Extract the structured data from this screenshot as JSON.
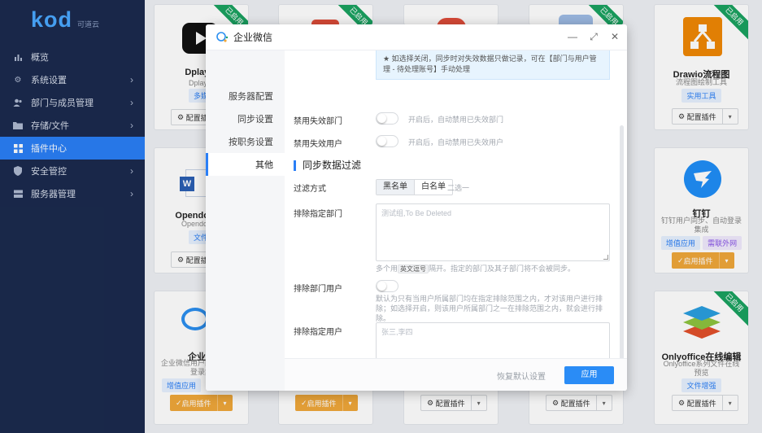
{
  "brand": {
    "logo": "kod",
    "logo_cn": "可道云"
  },
  "sidebar": {
    "items": [
      {
        "label": "概览",
        "icon": "bar-chart-icon"
      },
      {
        "label": "系统设置",
        "icon": "gear-icon"
      },
      {
        "label": "部门与成员管理",
        "icon": "users-icon"
      },
      {
        "label": "存储/文件",
        "icon": "folder-icon"
      },
      {
        "label": "插件中心",
        "icon": "grid-icon"
      },
      {
        "label": "安全管控",
        "icon": "shield-icon"
      },
      {
        "label": "服务器管理",
        "icon": "server-icon"
      }
    ]
  },
  "cards": {
    "dplayer": {
      "title": "Dplayer",
      "desc": "Dplayer",
      "tag": "多媒",
      "config": "配置插"
    },
    "drawio": {
      "title": "Drawio流程图",
      "desc": "流程图绘制工具",
      "tag": "实用工具",
      "config": "配置插件",
      "badge": "已启用"
    },
    "opendoc": {
      "title": "Opendocum",
      "desc": "Opendocum",
      "tag": "文件",
      "config": "配置插"
    },
    "dingtalk": {
      "title": "钉钉",
      "desc": "钉钉用户同步、自动登录集成",
      "tag1": "增值应用",
      "tag2": "需联外网",
      "enable": "启用插件"
    },
    "wework": {
      "title": "企业微",
      "desc": "企业微信用户同步、自动登录集",
      "tag": "增值应用",
      "enable": "启用插件"
    },
    "onlyoffice": {
      "title": "Onlyoffice在线编辑",
      "desc": "Onlyoffice系列文件在线预览",
      "tag": "文件增强",
      "config": "配置插件",
      "badge": "已启用"
    },
    "bottom2": {
      "enable": "启用插件"
    },
    "bottom3": {
      "config": "配置插件"
    },
    "bottom4": {
      "config": "配置插件"
    },
    "badge_text": "已启用"
  },
  "modal": {
    "title": "企业微信",
    "tabs": [
      "服务器配置",
      "同步设置",
      "按职务设置",
      "其他"
    ],
    "notice": "★ 如选择关闭，同步时对失效数据只做记录，可在【部门与用户管理 - 待处理账号】手动处理",
    "disable_dept_label": "禁用失效部门",
    "disable_dept_hint": "开启后，自动禁用已失效部门",
    "disable_user_label": "禁用失效用户",
    "disable_user_hint": "开启后，自动禁用已失效用户",
    "section_title": "同步数据过滤",
    "filter_label": "过滤方式",
    "filter_options": [
      "黑名单",
      "白名单"
    ],
    "filter_hint": "二选一",
    "exclude_dept_label": "排除指定部门",
    "exclude_dept_placeholder": "测试组,To Be Deleted",
    "exclude_dept_hint_a": "多个用",
    "exclude_dept_hint_kbd": "英文逗号",
    "exclude_dept_hint_b": "隔开。指定的部门及其子部门将不会被同步。",
    "exclude_dept_user_label": "排除部门用户",
    "exclude_dept_user_hint": "默认为只有当用户所属部门均在指定排除范围之内，才对该用户进行排除；如选择开启，则该用户所属部门之一在排除范围之内，就会进行排除。",
    "exclude_user_label": "排除指定用户",
    "exclude_user_placeholder": "张三,李四",
    "reset_label": "恢复默认设置",
    "apply_label": "应用"
  }
}
